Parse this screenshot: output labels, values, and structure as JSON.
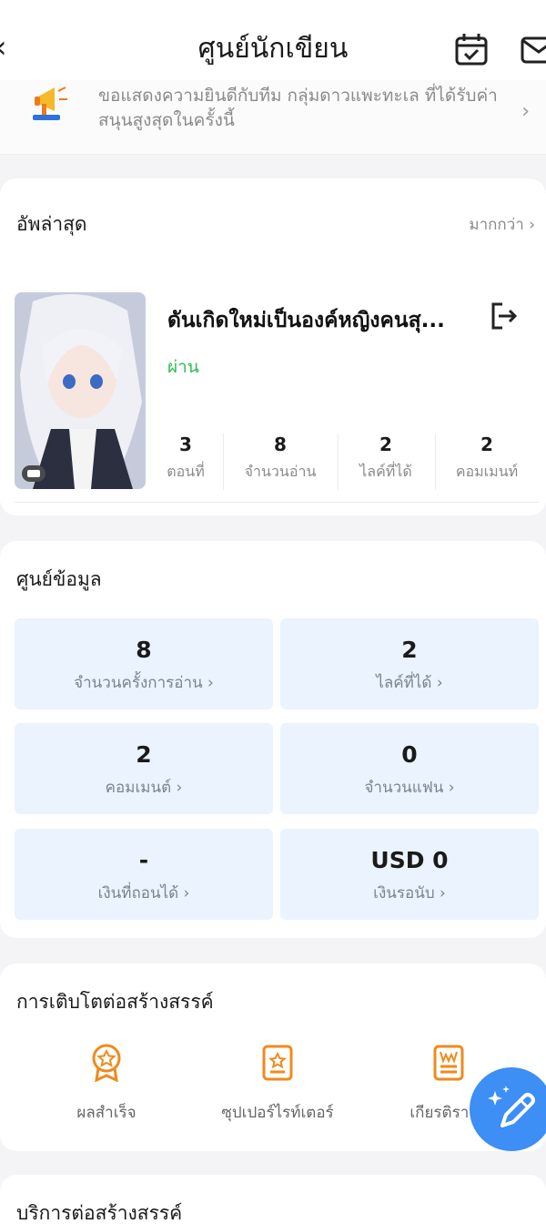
{
  "header": {
    "back_icon": "chevron-left-icon",
    "title": "ศูนย์นักเขียน",
    "calendar_icon": "calendar-check-icon",
    "mail_icon": "mail-icon"
  },
  "notice": {
    "text": "ขอแสดงความยินดีกับทีม กลุ่มดาวแพะทะเล ที่ได้รับค่าสนุนสูงสุดในครั้งนี้",
    "icon": "megaphone-icon"
  },
  "latest": {
    "title": "อัพล่าสุด",
    "more": "มากกว่า",
    "book": {
      "title": "ดันเกิดใหม่เป็นองค์หญิงคนสุ...",
      "status": "ผ่าน",
      "stats": [
        {
          "value": "3",
          "label": "ตอนที่"
        },
        {
          "value": "8",
          "label": "จำนวนอ่าน"
        },
        {
          "value": "2",
          "label": "ไลค์ที่ได้"
        },
        {
          "value": "2",
          "label": "คอมเมนท์"
        }
      ]
    }
  },
  "data_center": {
    "title": "ศูนย์ข้อมูล",
    "tiles": [
      {
        "value": "8",
        "label": "จำนวนครั้งการอ่าน"
      },
      {
        "value": "2",
        "label": "ไลค์ที่ได้"
      },
      {
        "value": "2",
        "label": "คอมเมนต์"
      },
      {
        "value": "0",
        "label": "จำนวนแฟน"
      },
      {
        "value": "-",
        "label": "เงินที่ถอนได้"
      },
      {
        "value": "USD 0",
        "label": "เงินรอนับ"
      }
    ]
  },
  "growth": {
    "title": "การเติบโตต่อสร้างสรรค์",
    "items": [
      {
        "label": "ผลสำเร็จ",
        "icon": "medal-icon"
      },
      {
        "label": "ซุปเปอร์ไรท์เตอร์",
        "icon": "star-badge-icon"
      },
      {
        "label": "เกียรติรายล",
        "icon": "certificate-icon"
      }
    ]
  },
  "services": {
    "title": "บริการต่อสร้างสรรค์"
  },
  "fab": {
    "icon": "pencil-sparkle-icon"
  },
  "colors": {
    "accent": "#f08a1c",
    "status_green": "#2bbd4f",
    "tile_bg": "#eaf3fe",
    "fab": "#3d8ef5"
  }
}
